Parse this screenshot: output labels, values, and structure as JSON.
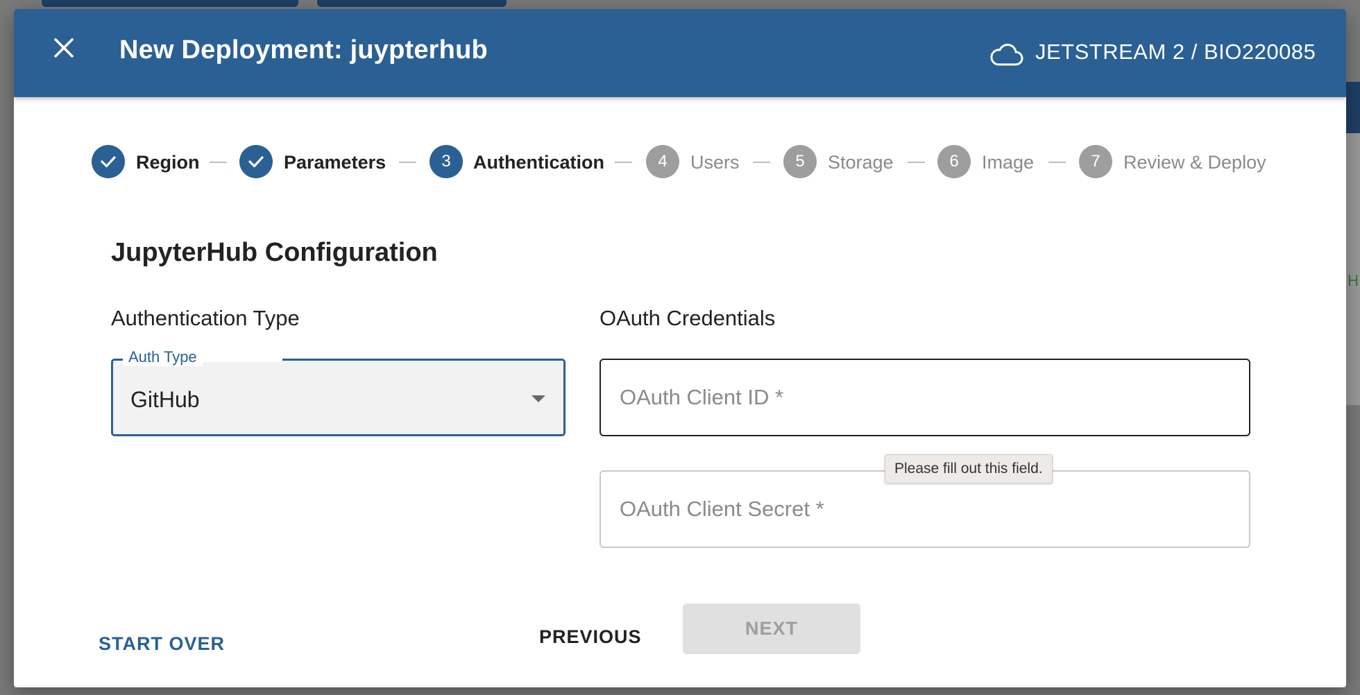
{
  "dialog": {
    "title": "New Deployment: juypterhub",
    "context": "JETSTREAM 2 / BIO220085",
    "context_icon": "cloud-icon",
    "close_icon": "close-icon",
    "accent_color": "#2b6094"
  },
  "stepper": {
    "steps": [
      {
        "index": "1",
        "label": "Region",
        "status": "done"
      },
      {
        "index": "2",
        "label": "Parameters",
        "status": "done"
      },
      {
        "index": "3",
        "label": "Authentication",
        "status": "active"
      },
      {
        "index": "4",
        "label": "Users",
        "status": "todo"
      },
      {
        "index": "5",
        "label": "Storage",
        "status": "todo"
      },
      {
        "index": "6",
        "label": "Image",
        "status": "todo"
      },
      {
        "index": "7",
        "label": "Review & Deploy",
        "status": "todo"
      }
    ]
  },
  "form": {
    "section_title": "JupyterHub Configuration",
    "auth_column_title": "Authentication Type",
    "auth_select": {
      "legend": "Auth Type",
      "value": "GitHub"
    },
    "oauth_column_title": "OAuth Credentials",
    "client_id": {
      "placeholder": "OAuth Client ID *",
      "value": ""
    },
    "client_secret": {
      "placeholder": "OAuth Client Secret *",
      "value": ""
    },
    "validation_tooltip": "Please fill out this field."
  },
  "actions": {
    "start_over": "START OVER",
    "previous": "PREVIOUS",
    "next": "NEXT"
  }
}
